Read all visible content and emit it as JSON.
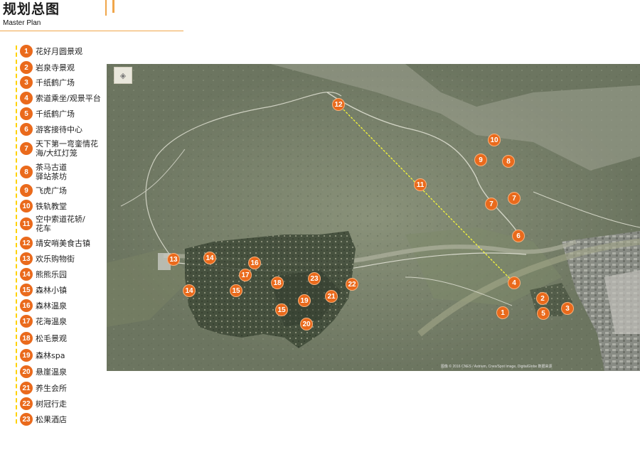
{
  "header": {
    "title": "规划总图",
    "subtitle": "Master Plan"
  },
  "colors": {
    "marker": "#ea6a1c",
    "accent_line": "#f0a64a",
    "legend_dash": "#ffd200",
    "cable_line": "#ffff33"
  },
  "legend": [
    {
      "num": "1",
      "label": "花好月圆景观"
    },
    {
      "num": "2",
      "label": "岩泉寺景观"
    },
    {
      "num": "3",
      "label": "千纸鹤广场"
    },
    {
      "num": "4",
      "label": "索道乘坐/观景平台"
    },
    {
      "num": "5",
      "label": "千纸鹤广场"
    },
    {
      "num": "6",
      "label": "游客接待中心"
    },
    {
      "num": "7",
      "label": "天下第一弯銮情花\n海/大红灯笼"
    },
    {
      "num": "8",
      "label": "茶马古道\n驿站茶坊"
    },
    {
      "num": "9",
      "label": "飞虎广场"
    },
    {
      "num": "10",
      "label": "铁轨教堂"
    },
    {
      "num": "11",
      "label": "空中索道花轿/\n花车"
    },
    {
      "num": "12",
      "label": "靖安哨美食古镇"
    },
    {
      "num": "13",
      "label": "欢乐购物街"
    },
    {
      "num": "14",
      "label": "熊熊乐园"
    },
    {
      "num": "15",
      "label": "森林小镇"
    },
    {
      "num": "16",
      "label": "森林温泉"
    },
    {
      "num": "17",
      "label": "花海温泉"
    },
    {
      "num": "18",
      "label": "松毛景观"
    },
    {
      "num": "19",
      "label": "森林spa"
    },
    {
      "num": "20",
      "label": "悬崖温泉"
    },
    {
      "num": "21",
      "label": "养生会所"
    },
    {
      "num": "22",
      "label": "树冠行走"
    },
    {
      "num": "23",
      "label": "松果酒店"
    }
  ],
  "map": {
    "markers": [
      "12",
      "10",
      "9",
      "8",
      "11",
      "7",
      "7",
      "6",
      "4",
      "2",
      "5",
      "3",
      "1",
      "13",
      "14",
      "14",
      "16",
      "17",
      "15",
      "18",
      "23",
      "22",
      "21",
      "19",
      "15",
      "20"
    ],
    "attribution": "图像 © 2016 CNES / Astrium, Cnes/Spot Image, DigitalGlobe 数据来源"
  }
}
